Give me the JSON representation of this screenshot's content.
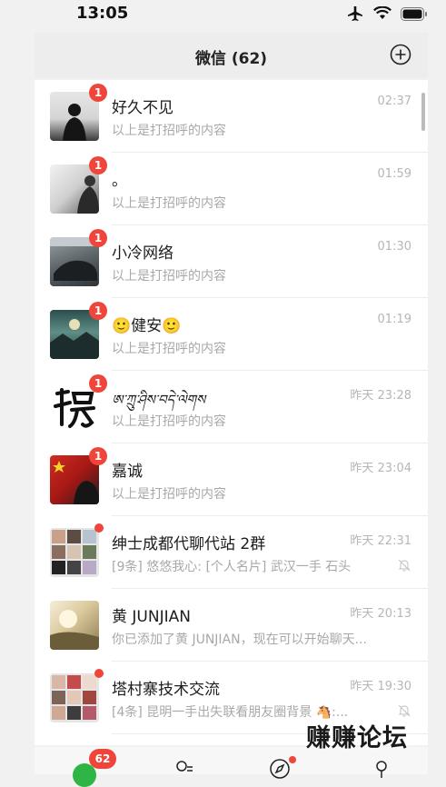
{
  "status": {
    "time": "13:05"
  },
  "header": {
    "title": "微信 (62)"
  },
  "chats": [
    {
      "name": "好久不见",
      "time": "02:37",
      "preview": "以上是打招呼的内容",
      "badge": "1"
    },
    {
      "name": "。",
      "time": "01:59",
      "preview": "以上是打招呼的内容",
      "badge": "1"
    },
    {
      "name": "小冷网络",
      "time": "01:30",
      "preview": "以上是打招呼的内容",
      "badge": "1"
    },
    {
      "name": "🙂健安🙂",
      "time": "01:19",
      "preview": "以上是打招呼的内容",
      "badge": "1"
    },
    {
      "name": "ཨ་ཀྲུ་ཤིས་བདེ་ལེགས",
      "time": "昨天 23:28",
      "preview": "以上是打招呼的内容",
      "badge": "1"
    },
    {
      "name": "嘉诚",
      "time": "昨天 23:04",
      "preview": "以上是打招呼的内容",
      "badge": "1"
    },
    {
      "name": "绅士成都代聊代站 2群",
      "time": "昨天 22:31",
      "preview": "[9条] 悠悠我心: [个人名片] 武汉一手  石头",
      "muted": true
    },
    {
      "name": "黄 JUNJIAN",
      "time": "昨天 20:13",
      "preview": "你已添加了黄 JUNJIAN，现在可以开始聊天..."
    },
    {
      "name": "塔村寨技术交流",
      "time": "昨天 19:30",
      "preview": "[4条] 昆明一手出失联看朋友圈背景 🐴:...",
      "muted": true
    }
  ],
  "tabbar": {
    "chats_badge": "62"
  },
  "watermark": "赚赚论坛"
}
